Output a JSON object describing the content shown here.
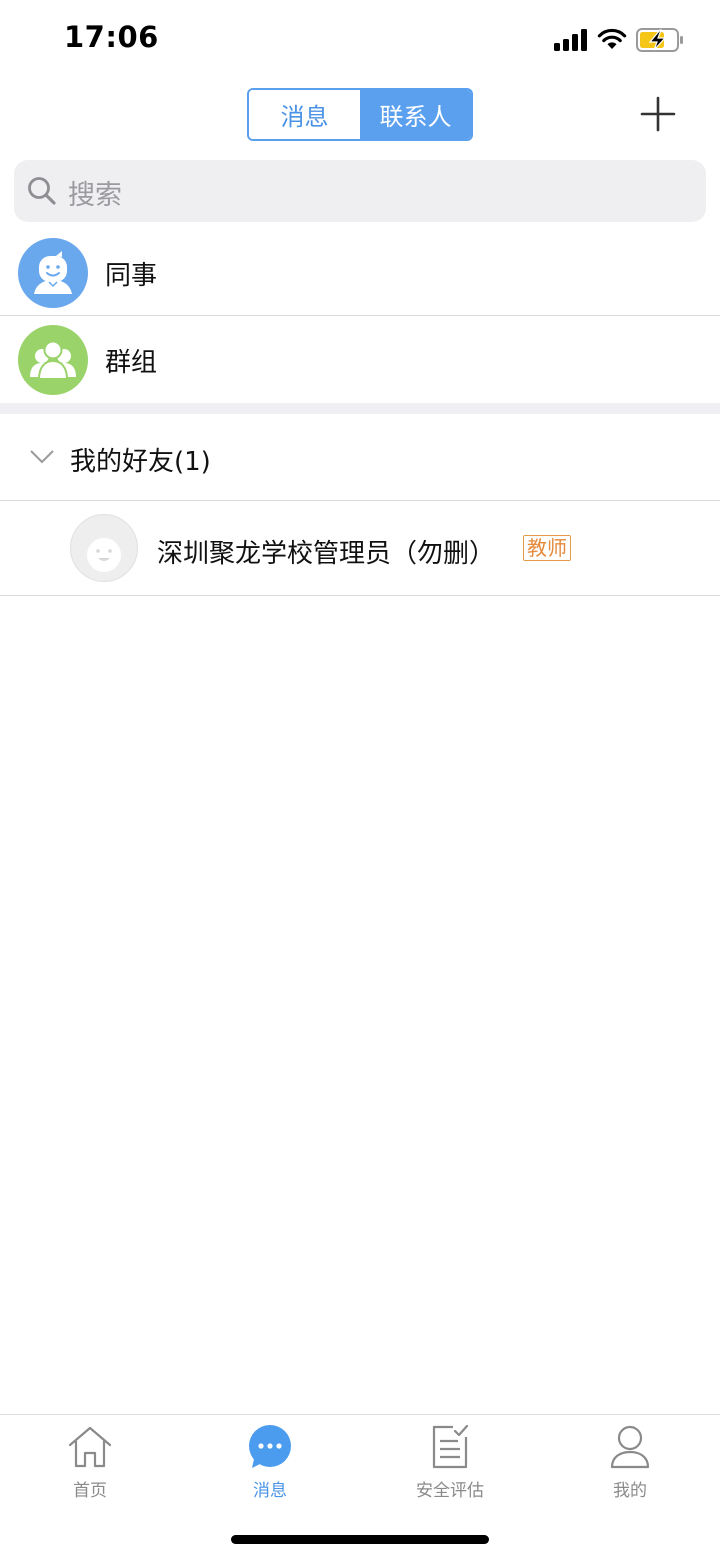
{
  "status_bar": {
    "time": "17:06"
  },
  "header": {
    "tabs": [
      {
        "label": "消息",
        "active": false
      },
      {
        "label": "联系人",
        "active": true
      }
    ],
    "add_icon": "plus-icon"
  },
  "search": {
    "placeholder": "搜索"
  },
  "entries": [
    {
      "label": "同事",
      "icon": "colleague-avatar-icon",
      "color": "#6aa8ee"
    },
    {
      "label": "群组",
      "icon": "group-avatar-icon",
      "color": "#9ad36a"
    }
  ],
  "friends_section": {
    "title": "我的好友(1)",
    "expanded": true,
    "items": [
      {
        "name": "深圳聚龙学校管理员（勿删）",
        "tag": "教师",
        "icon": "default-avatar-icon"
      }
    ]
  },
  "tab_bar": {
    "items": [
      {
        "label": "首页",
        "icon": "home-icon",
        "active": false
      },
      {
        "label": "消息",
        "icon": "message-icon",
        "active": true
      },
      {
        "label": "安全评估",
        "icon": "assessment-icon",
        "active": false
      },
      {
        "label": "我的",
        "icon": "profile-icon",
        "active": false
      }
    ]
  },
  "colors": {
    "accent": "#5aa0ee",
    "tag": "#e5893a"
  }
}
